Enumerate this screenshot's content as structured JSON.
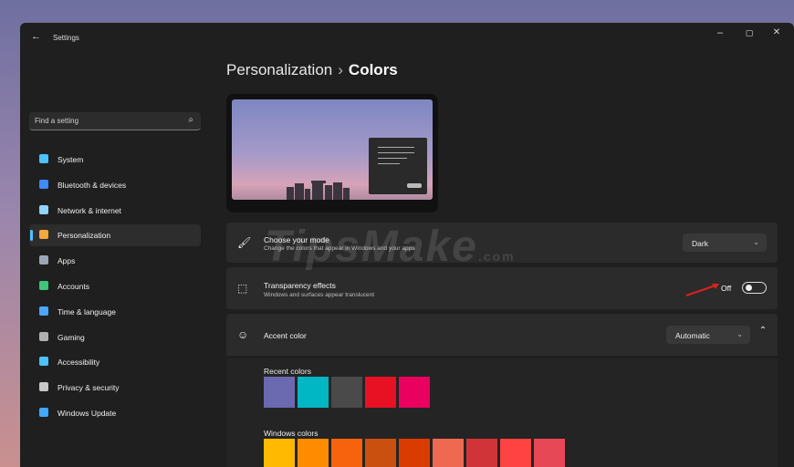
{
  "titlebar": {
    "title": "Settings",
    "back": "←",
    "minimize": "–",
    "maximize": "▢",
    "close": "✕"
  },
  "search": {
    "placeholder": "Find a setting",
    "icon": "search-icon"
  },
  "sidebar": {
    "items": [
      {
        "label": "System",
        "icon": "system-icon",
        "color": "#4cc2ff"
      },
      {
        "label": "Bluetooth & devices",
        "icon": "bluetooth-icon",
        "color": "#3d8bff"
      },
      {
        "label": "Network & internet",
        "icon": "wifi-icon",
        "color": "#8fd3ff"
      },
      {
        "label": "Personalization",
        "icon": "brush-icon",
        "color": "#f2a83b",
        "active": true
      },
      {
        "label": "Apps",
        "icon": "apps-icon",
        "color": "#9aa6b8"
      },
      {
        "label": "Accounts",
        "icon": "person-icon",
        "color": "#3fc57a"
      },
      {
        "label": "Time & language",
        "icon": "globe-clock-icon",
        "color": "#4ca6ff"
      },
      {
        "label": "Gaming",
        "icon": "gamepad-icon",
        "color": "#b0b0b0"
      },
      {
        "label": "Accessibility",
        "icon": "accessibility-icon",
        "color": "#4cc2ff"
      },
      {
        "label": "Privacy & security",
        "icon": "shield-icon",
        "color": "#c8c8c8"
      },
      {
        "label": "Windows Update",
        "icon": "update-icon",
        "color": "#3fa8ff"
      }
    ]
  },
  "header": {
    "parent": "Personalization",
    "separator": "›",
    "current": "Colors"
  },
  "mode": {
    "title": "Choose your mode",
    "description": "Change the colors that appear in Windows and your apps",
    "value": "Dark",
    "icon": "brush-mode-icon"
  },
  "transparency": {
    "title": "Transparency effects",
    "description": "Windows and surfaces appear translucent",
    "state_label": "Off",
    "on": false,
    "icon": "transparency-icon"
  },
  "accent": {
    "title": "Accent color",
    "value": "Automatic",
    "icon": "palette-icon",
    "recent_label": "Recent colors",
    "recent_colors": [
      "#6b69b0",
      "#00b7c3",
      "#4a4a4a",
      "#e81123",
      "#ea005e"
    ],
    "windows_label": "Windows colors",
    "windows_colors": [
      "#ffb900",
      "#ff8c00",
      "#f7630c",
      "#ca5010",
      "#da3b01",
      "#ef6950",
      "#d13438",
      "#ff4343",
      "#e74856"
    ]
  },
  "watermark": {
    "text": "TipsMake",
    "suffix": ".com"
  }
}
